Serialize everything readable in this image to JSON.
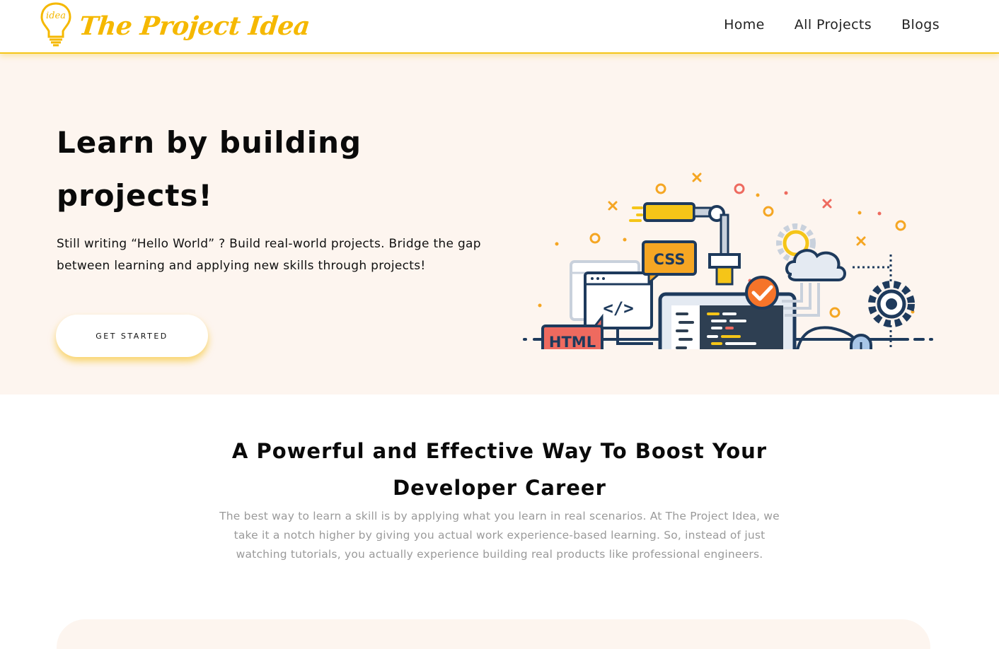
{
  "header": {
    "logo_text": "The Project Idea",
    "logo_icon_word": "idea",
    "nav": [
      "Home",
      "All Projects",
      "Blogs"
    ]
  },
  "hero": {
    "title": "Learn by building projects!",
    "description": "Still writing “Hello World” ? Build real-world projects. Bridge the gap between learning and applying new skills through projects!",
    "cta_label": "GET STARTED",
    "illustration": {
      "badge_css": "CSS",
      "badge_html": "HTML",
      "code_symbol": "</>"
    }
  },
  "section": {
    "title": "A Powerful and Effective Way To Boost Your Developer Career",
    "description": "The best way to learn a skill is by applying what you learn in real scenarios. At The Project Idea, we take it a notch higher by giving you actual work experience-based learning. So, instead of just watching tutorials, you actually experience building real products like professional engineers."
  },
  "colors": {
    "accent": "#f5c518",
    "hero_bg": "#fdf5ef",
    "muted_text": "#9a9a9a",
    "badge_red": "#ee6a5f",
    "badge_orange": "#f5a623",
    "navy": "#1e3a5c"
  },
  "icons": [
    "lightbulb-icon",
    "code-icon",
    "check-icon",
    "gear-icon",
    "cloud-icon",
    "mouse-icon",
    "laptop-icon",
    "robot-arm-icon"
  ]
}
